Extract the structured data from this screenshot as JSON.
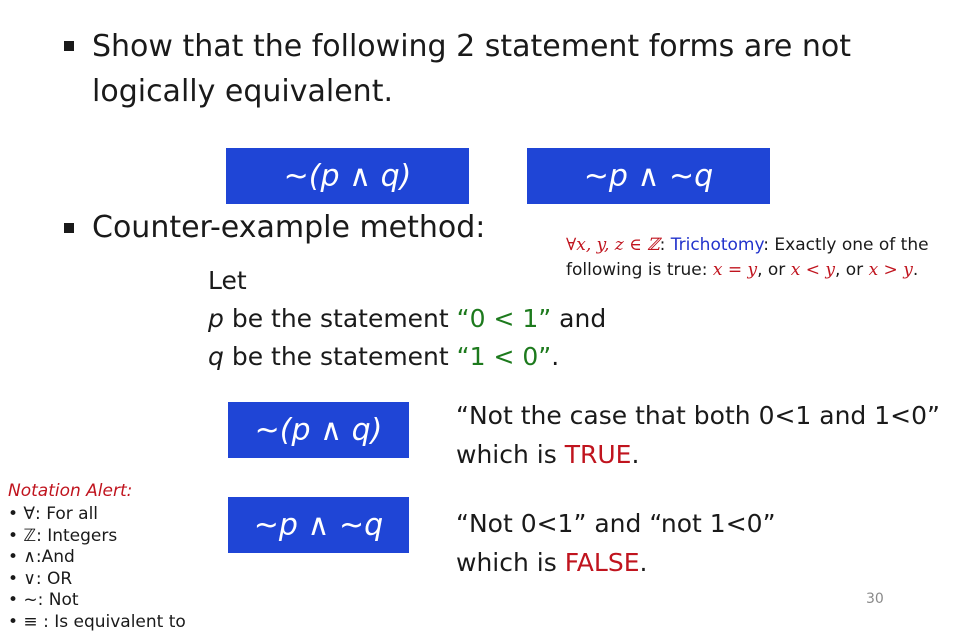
{
  "heading": {
    "line1": "Show that the following 2 statement forms are not",
    "line2": "logically equivalent."
  },
  "forms": {
    "left": "~(p ∧ q)",
    "right": "~p ∧ ~q"
  },
  "method": {
    "label": "Counter-example method:"
  },
  "trichotomy": {
    "quantifier": "∀x, y, z ∈ ℤ",
    "colon": ":",
    "name": "Trichotomy",
    "line1_rest": ": Exactly one of the",
    "line2_prefix": "following is true:",
    "eq1": "x = y",
    "or1": ", or",
    "eq2": "x < y",
    "or2": ", or",
    "eq3": "x > y",
    "end": "."
  },
  "let": {
    "word": "Let",
    "p_var": "p",
    "p_text": " be the statement ",
    "p_quote": "“0 < 1”",
    "p_end": " and",
    "q_var": "q",
    "q_text": " be the statement ",
    "q_quote": "“1 < 0”",
    "q_end": "."
  },
  "example1": {
    "box": "~(p ∧ q)",
    "line1": "“Not the case that both 0<1 and 1<0”",
    "line2_prefix": "which is ",
    "line2_value": "TRUE",
    "line2_end": "."
  },
  "example2": {
    "box": "~p ∧ ~q",
    "line1": "“Not 0<1” and “not 1<0”",
    "line2_prefix": "which is ",
    "line2_value": "FALSE",
    "line2_end": "."
  },
  "notation": {
    "title": "Notation Alert:",
    "items": [
      "• ∀: For all",
      "• ℤ: Integers",
      "• ∧:And",
      "• ∨: OR",
      "• ~: Not",
      "• ≡ : Is equivalent to"
    ]
  },
  "page_number": "30",
  "colors": {
    "box_blue": "#1f45d6",
    "green": "#1d7a1d",
    "red": "#c0141e",
    "trichotomy_blue": "#2233cc"
  }
}
